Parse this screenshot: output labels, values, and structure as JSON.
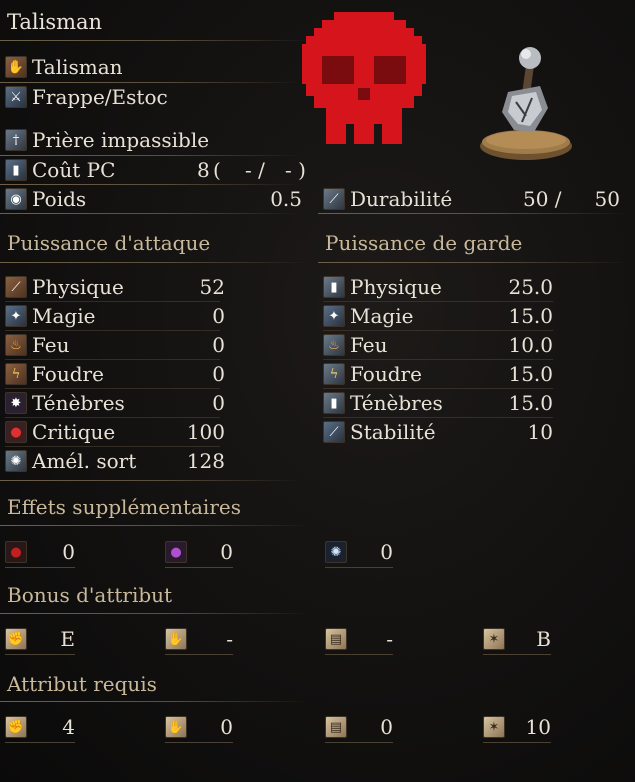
{
  "title": "Talisman",
  "item_info": {
    "type_label": "Talisman",
    "attack_type": "Frappe/Estoc",
    "skill": "Prière impassible",
    "fp_cost_label": "Coût PC",
    "fp_cost_value": "8",
    "fp_cost_open": "(",
    "fp_cost_mid": "- /",
    "fp_cost_close": "- )",
    "weight_label": "Poids",
    "weight_value": "0.5",
    "durability_label": "Durabilité",
    "durability_current": "50 /",
    "durability_max": "50"
  },
  "attack": {
    "header": "Puissance d'attaque",
    "rows": [
      {
        "label": "Physique",
        "value": "52",
        "icon": "physical-icon"
      },
      {
        "label": "Magie",
        "value": "0",
        "icon": "magic-icon"
      },
      {
        "label": "Feu",
        "value": "0",
        "icon": "fire-icon"
      },
      {
        "label": "Foudre",
        "value": "0",
        "icon": "lightning-icon"
      },
      {
        "label": "Ténèbres",
        "value": "0",
        "icon": "dark-icon"
      },
      {
        "label": "Critique",
        "value": "100",
        "icon": "critical-icon"
      },
      {
        "label": "Amél. sort",
        "value": "128",
        "icon": "spell-buff-icon"
      }
    ]
  },
  "guard": {
    "header": "Puissance de garde",
    "rows": [
      {
        "label": "Physique",
        "value": "25.0"
      },
      {
        "label": "Magie",
        "value": "15.0"
      },
      {
        "label": "Feu",
        "value": "10.0"
      },
      {
        "label": "Foudre",
        "value": "15.0"
      },
      {
        "label": "Ténèbres",
        "value": "15.0"
      },
      {
        "label": "Stabilité",
        "value": "10"
      }
    ]
  },
  "effects": {
    "header": "Effets supplémentaires",
    "slots": [
      {
        "icon": "bleed-icon",
        "value": "0"
      },
      {
        "icon": "poison-icon",
        "value": "0"
      },
      {
        "icon": "frost-icon",
        "value": "0"
      }
    ]
  },
  "scaling": {
    "header": "Bonus d'attribut",
    "slots": [
      {
        "icon": "strength-icon",
        "value": "E"
      },
      {
        "icon": "dexterity-icon",
        "value": "-"
      },
      {
        "icon": "intelligence-icon",
        "value": "-"
      },
      {
        "icon": "faith-icon",
        "value": "B"
      }
    ]
  },
  "requirements": {
    "header": "Attribut requis",
    "slots": [
      {
        "icon": "strength-icon",
        "value": "4"
      },
      {
        "icon": "dexterity-icon",
        "value": "0"
      },
      {
        "icon": "intelligence-icon",
        "value": "0"
      },
      {
        "icon": "faith-icon",
        "value": "10"
      }
    ]
  },
  "colors": {
    "skull": "#d6141c",
    "header": "#c9b99a",
    "text": "#e8e2d6"
  }
}
